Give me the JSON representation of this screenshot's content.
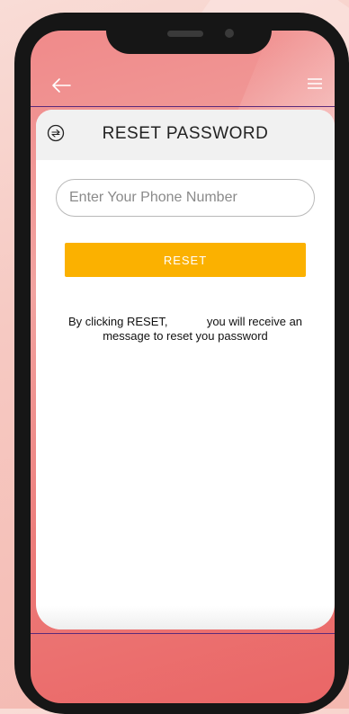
{
  "header": {
    "title": "RESET PASSWORD",
    "back_icon": "arrow-left-icon",
    "menu_icon": "hamburger-menu-icon",
    "logout_icon": "logout-icon"
  },
  "form": {
    "phone_placeholder": "Enter Your Phone Number",
    "phone_value": "",
    "reset_label": "RESET"
  },
  "info": {
    "line1": "By clicking RESET,            you will receive an",
    "line2": "message to reset you password"
  },
  "colors": {
    "accent": "#fbb100",
    "screen_gradient_start": "#f08a8a",
    "screen_gradient_end": "#ea6666",
    "divider": "#5b2a7a"
  }
}
